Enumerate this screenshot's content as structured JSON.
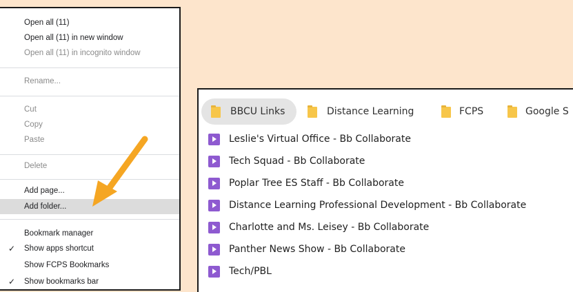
{
  "context_menu": {
    "items": [
      {
        "label": "Open all (11)"
      },
      {
        "label": "Open all (11) in new window"
      },
      {
        "label": "Open all (11) in incognito window"
      },
      {
        "label": "Rename..."
      },
      {
        "label": "Cut"
      },
      {
        "label": "Copy"
      },
      {
        "label": "Paste"
      },
      {
        "label": "Delete"
      },
      {
        "label": "Add page..."
      },
      {
        "label": "Add folder..."
      },
      {
        "label": "Bookmark manager"
      },
      {
        "label": "Show apps shortcut"
      },
      {
        "label": "Show FCPS Bookmarks"
      },
      {
        "label": "Show bookmarks bar"
      }
    ],
    "check_glyph": "✓",
    "arrow_color": "#f5a623"
  },
  "bookmarks_bar": {
    "folders": [
      {
        "label": "BBCU Links"
      },
      {
        "label": "Distance Learning"
      },
      {
        "label": "FCPS"
      },
      {
        "label": "Google S"
      }
    ],
    "folder_color": "#f7c64a",
    "items": [
      {
        "label": "Leslie's Virtual Office - Bb Collaborate"
      },
      {
        "label": "Tech Squad - Bb Collaborate"
      },
      {
        "label": "Poplar Tree ES Staff - Bb Collaborate"
      },
      {
        "label": "Distance Learning Professional Development - Bb Collaborate"
      },
      {
        "label": "Charlotte and Ms. Leisey - Bb Collaborate"
      },
      {
        "label": "Panther News Show - Bb Collaborate"
      },
      {
        "label": "Tech/PBL"
      }
    ],
    "item_icon": "bb-collaborate-icon",
    "item_icon_color": "#8e5ad0"
  }
}
